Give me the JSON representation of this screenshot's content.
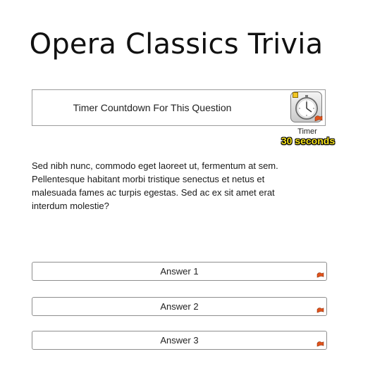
{
  "title": "Opera Classics Trivia",
  "timer": {
    "box_label": "Timer Countdown For This Question",
    "caption": "Timer",
    "value": "30 seconds",
    "icon": "stopwatch-icon"
  },
  "question": {
    "text": "Sed nibh nunc, commodo eget laoreet ut, fermentum at sem. Pellentesque habitant morbi tristique senectus et netus et malesuada fames ac turpis egestas. Sed ac ex sit amet erat interdum molestie?"
  },
  "answers": [
    {
      "label": "Answer 1"
    },
    {
      "label": "Answer 2"
    },
    {
      "label": "Answer 3"
    }
  ],
  "colors": {
    "timer_value_text": "#f5e11a",
    "flag_accent": "#e0531c"
  }
}
